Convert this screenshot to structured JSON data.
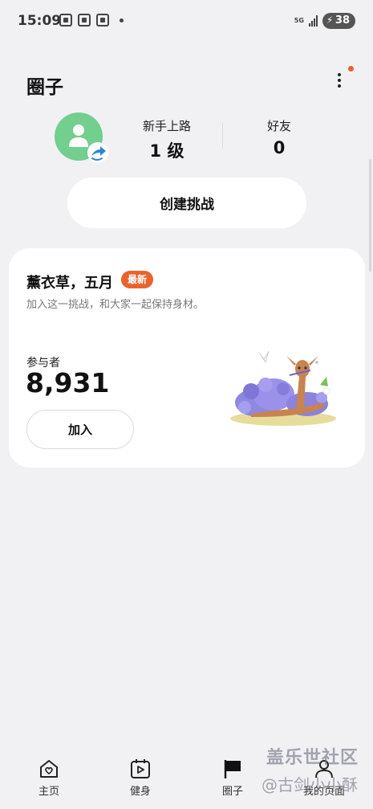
{
  "status_bar": {
    "time": "15:09",
    "network": "5G",
    "battery": "38"
  },
  "header": {
    "title": "圈子"
  },
  "profile": {
    "level_label": "新手上路",
    "level_value": "1 级",
    "friends_label": "好友",
    "friends_value": "0"
  },
  "create_button": "创建挑战",
  "challenge": {
    "title": "薰衣草，五月",
    "badge": "最新",
    "description": "加入这一挑战，和大家一起保持身材。",
    "participants_label": "参与者",
    "participants_count": "8,931",
    "join_label": "加入"
  },
  "bottom_nav": {
    "items": [
      {
        "label": "主页",
        "icon": "heart-home-icon"
      },
      {
        "label": "健身",
        "icon": "play-calendar-icon"
      },
      {
        "label": "圈子",
        "icon": "flag-icon",
        "active": true
      },
      {
        "label": "我的页面",
        "icon": "person-icon"
      }
    ]
  },
  "watermark": {
    "line1": "盖乐世社区",
    "line2": "@古剑小小酥"
  },
  "colors": {
    "accent": "#e8642c",
    "avatar_bg": "#72cf8e",
    "background": "#f1f1f3"
  }
}
